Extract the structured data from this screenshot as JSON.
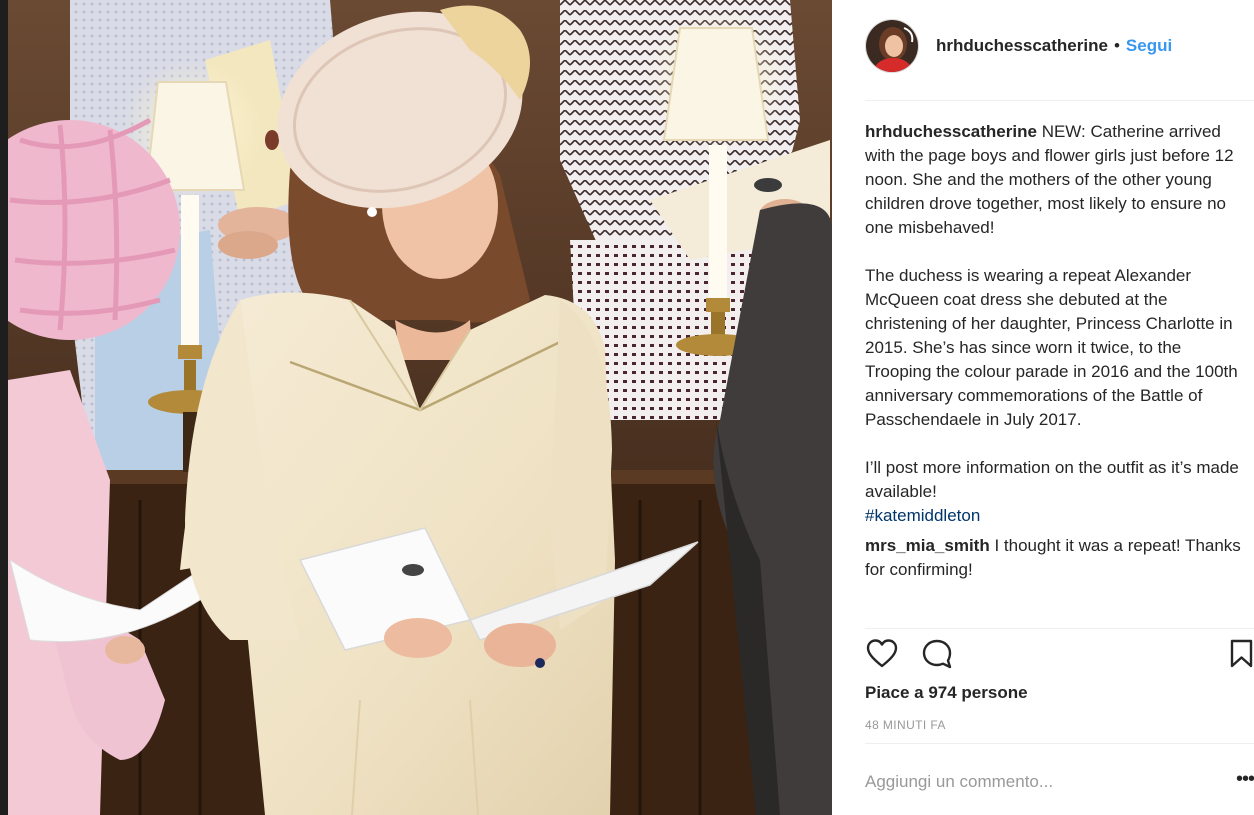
{
  "header": {
    "username": "hrhduchesscatherine",
    "separator": "•",
    "follow_label": "Segui"
  },
  "caption": {
    "username": "hrhduchesscatherine",
    "paragraph_1": "NEW: Catherine arrived with the page boys and flower girls just before 12 noon. She and the mothers of the other young children drove together, most likely to ensure no one misbehaved!",
    "paragraph_2": "The duchess is wearing a repeat Alexander McQueen coat dress she debuted at the christening of her daughter, Princess Charlotte in 2015. She’s has since worn it twice, to the Trooping the colour parade in 2016 and the 100th anniversary commemorations of the Battle of Passchendaele in July 2017.",
    "paragraph_3": "I’ll post more information on the outfit as it’s made available!",
    "hashtag": "#katemiddleton"
  },
  "comments": [
    {
      "username": "mrs_mia_smith",
      "text": "I thought it was a repeat! Thanks for confirming!"
    }
  ],
  "actions": {
    "like_icon": "heart-outline-icon",
    "comment_icon": "speech-bubble-icon",
    "save_icon": "bookmark-icon"
  },
  "likes_text": "Piace a 974 persone",
  "time_ago": "48 MINUTI FA",
  "comment_input": {
    "placeholder": "Aggiungi un commento...",
    "value": ""
  },
  "more_options": "•••",
  "colors": {
    "link_blue": "#3897f0",
    "hashtag_blue": "#003569",
    "text": "#262626",
    "muted": "#999999",
    "divider": "#efefef"
  }
}
